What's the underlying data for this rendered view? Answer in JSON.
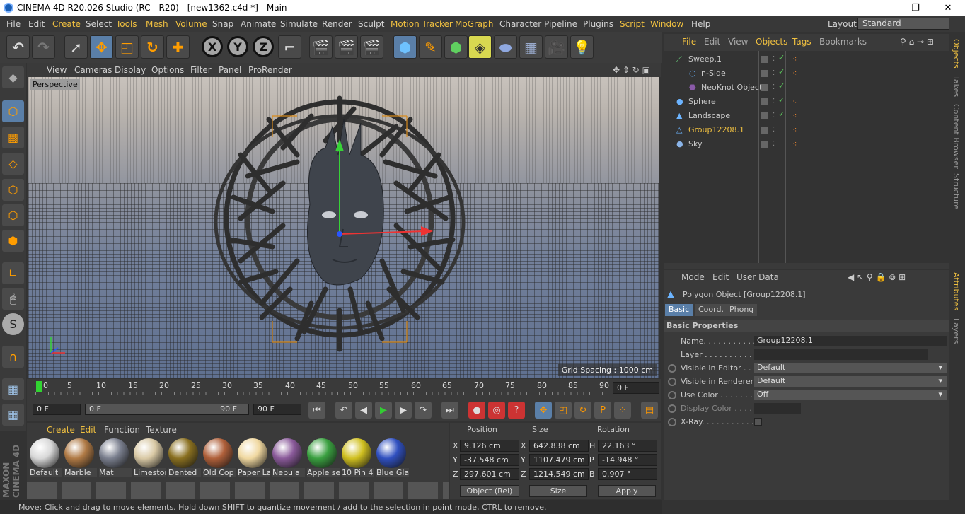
{
  "window": {
    "title": "CINEMA 4D R20.026 Studio (RC - R20) - [new1362.c4d *] - Main",
    "min": "—",
    "max": "❐",
    "close": "✕"
  },
  "menu": {
    "items": [
      "File",
      "Edit",
      "Create",
      "Select",
      "Tools",
      "Mesh",
      "Volume",
      "Snap",
      "Animate",
      "Simulate",
      "Render",
      "Sculpt",
      "Motion Tracker",
      "MoGraph",
      "Character",
      "Pipeline",
      "Plugins",
      "Script",
      "Window",
      "Help"
    ],
    "layout_label": "Layout:",
    "layout_value": "Standard"
  },
  "viewport": {
    "menu": [
      "View",
      "Cameras",
      "Display",
      "Options",
      "Filter",
      "Panel",
      "ProRender"
    ],
    "label": "Perspective",
    "grid_spacing": "Grid Spacing : 1000 cm"
  },
  "timeline": {
    "ticks": [
      "0",
      "5",
      "10",
      "15",
      "20",
      "25",
      "30",
      "35",
      "40",
      "45",
      "50",
      "55",
      "60",
      "65",
      "70",
      "75",
      "80",
      "85",
      "90"
    ],
    "current": "0 F"
  },
  "transport": {
    "start": "0 F",
    "range_start": "0 F",
    "range_end": "90 F",
    "end": "90 F"
  },
  "materials": {
    "menu": [
      "Create",
      "Edit",
      "Function",
      "Texture"
    ],
    "items": [
      {
        "name": "Default",
        "color": "#d8d8d8"
      },
      {
        "name": "Marble",
        "color": "#b07a45"
      },
      {
        "name": "Mat",
        "color": "#7a7f8e"
      },
      {
        "name": "Limestone",
        "color": "#d9c9a5"
      },
      {
        "name": "Dented",
        "color": "#8a7020"
      },
      {
        "name": "Old Cop",
        "color": "#b0603a"
      },
      {
        "name": "Paper La",
        "color": "#f0d8a0"
      },
      {
        "name": "Nebula",
        "color": "#8a5a9a"
      },
      {
        "name": "Apple se",
        "color": "#3aa040"
      },
      {
        "name": "10 Pin 4",
        "color": "#d0c020"
      },
      {
        "name": "Blue Gla",
        "color": "#3050c0"
      }
    ]
  },
  "coords": {
    "headers": [
      "Position",
      "Size",
      "Rotation"
    ],
    "rows": [
      {
        "axis": "X",
        "pos": "9.126 cm",
        "saxis": "X",
        "size": "642.838 cm",
        "raxis": "H",
        "rot": "22.163 °"
      },
      {
        "axis": "Y",
        "pos": "-37.548 cm",
        "saxis": "Y",
        "size": "1107.479 cm",
        "raxis": "P",
        "rot": "-14.948 °"
      },
      {
        "axis": "Z",
        "pos": "297.601 cm",
        "saxis": "Z",
        "size": "1214.549 cm",
        "raxis": "B",
        "rot": "0.907 °"
      }
    ],
    "mode": "Object (Rel)",
    "size_mode": "Size",
    "apply": "Apply"
  },
  "status": "Move: Click and drag to move elements. Hold down SHIFT to quantize movement / add to the selection in point mode, CTRL to remove.",
  "objects": {
    "menu": [
      "File",
      "Edit",
      "View",
      "Objects",
      "Tags",
      "Bookmarks"
    ],
    "rows": [
      {
        "name": "Sweep.1",
        "indent": 0
      },
      {
        "name": "n-Side",
        "indent": 1
      },
      {
        "name": "NeoKnot Object",
        "indent": 1
      },
      {
        "name": "Sphere",
        "indent": 0
      },
      {
        "name": "Landscape",
        "indent": 0
      },
      {
        "name": "Group12208.1",
        "indent": 0
      },
      {
        "name": "Sky",
        "indent": 0
      }
    ]
  },
  "attributes": {
    "menu": [
      "Mode",
      "Edit",
      "User Data"
    ],
    "object": "Polygon Object [Group12208.1]",
    "tabs": [
      "Basic",
      "Coord.",
      "Phong"
    ],
    "section": "Basic Properties",
    "props": [
      {
        "label": "Name. . . . . . . . . . . .",
        "value": "Group12208.1"
      },
      {
        "label": "Layer . . . . . . . . . . . .",
        "value": ""
      },
      {
        "label": "Visible in Editor . . .",
        "value": "Default"
      },
      {
        "label": "Visible in Renderer",
        "value": "Default"
      },
      {
        "label": "Use Color . . . . . . . .",
        "value": "Off"
      },
      {
        "label": "Display Color . . . .",
        "value": ""
      },
      {
        "label": "X-Ray. . . . . . . . . . . .",
        "value": ""
      }
    ]
  },
  "side_tabs": [
    "Objects",
    "Takes",
    "Content Browser",
    "Structure",
    "Attributes",
    "Layers"
  ]
}
